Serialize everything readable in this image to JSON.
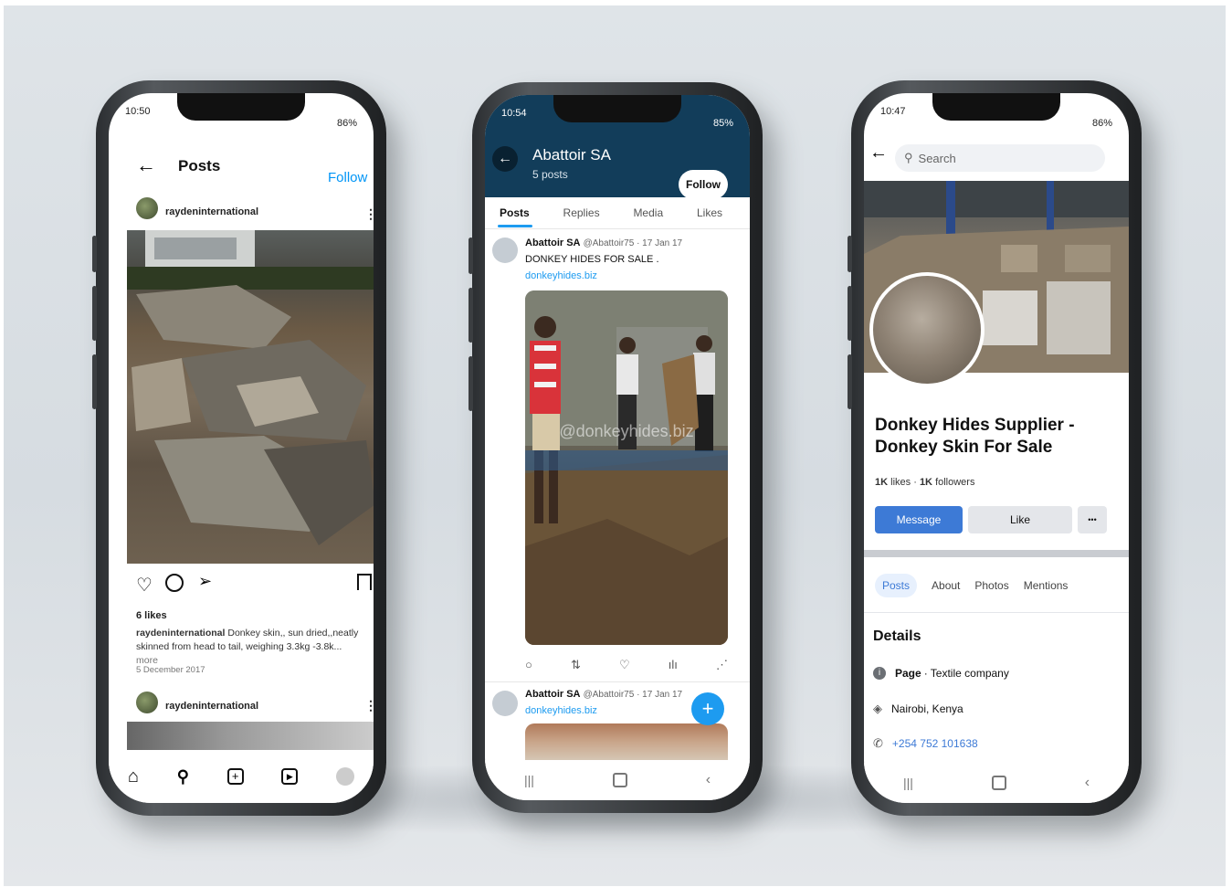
{
  "phone_instagram": {
    "status_time": "10:50",
    "battery": "86%",
    "header_title": "Posts",
    "follow_label": "Follow",
    "post1": {
      "username": "raydeninternational",
      "likes": "6 likes",
      "caption_user": "raydeninternational",
      "caption_text": "Donkey skin,, sun dried,,neatly skinned from head to tail, weighing 3.3kg -3.8k...",
      "more_label": "more",
      "date": "5 December 2017"
    },
    "post2": {
      "username": "raydeninternational"
    }
  },
  "phone_twitter": {
    "status_time": "10:54",
    "battery": "85%",
    "profile_name": "Abattoir SA",
    "posts_count": "5 posts",
    "follow_label": "Follow",
    "tabs": [
      "Posts",
      "Replies",
      "Media",
      "Likes"
    ],
    "tweet1": {
      "name": "Abattoir SA",
      "handle_date": "@Abattoir75 · 17 Jan 17",
      "text": "DONKEY HIDES FOR SALE .",
      "link": "donkeyhides.biz",
      "watermark": "@donkeyhides.biz"
    },
    "tweet2": {
      "name": "Abattoir SA",
      "handle_date": "@Abattoir75 · 17 Jan 17",
      "link": "donkeyhides.biz"
    },
    "fab_symbol": "+"
  },
  "phone_facebook": {
    "status_time": "10:47",
    "battery": "86%",
    "search_placeholder": "Search",
    "page_title": "Donkey Hides Supplier - Donkey Skin For Sale",
    "likes_count": "1K",
    "likes_label": "likes",
    "followers_count": "1K",
    "followers_label": "followers",
    "message_label": "Message",
    "like_label": "Like",
    "more_label": "•••",
    "tabs": [
      "Posts",
      "About",
      "Photos",
      "Mentions"
    ],
    "details_heading": "Details",
    "page_label": "Page",
    "page_category": "· Textile company",
    "location": "Nairobi, Kenya",
    "phone": "+254 752 101638"
  },
  "colors": {
    "twitter_header": "#123d5a",
    "twitter_blue": "#1d9bf0",
    "facebook_blue": "#3d7ad6",
    "instagram_follow": "#0095f6"
  }
}
